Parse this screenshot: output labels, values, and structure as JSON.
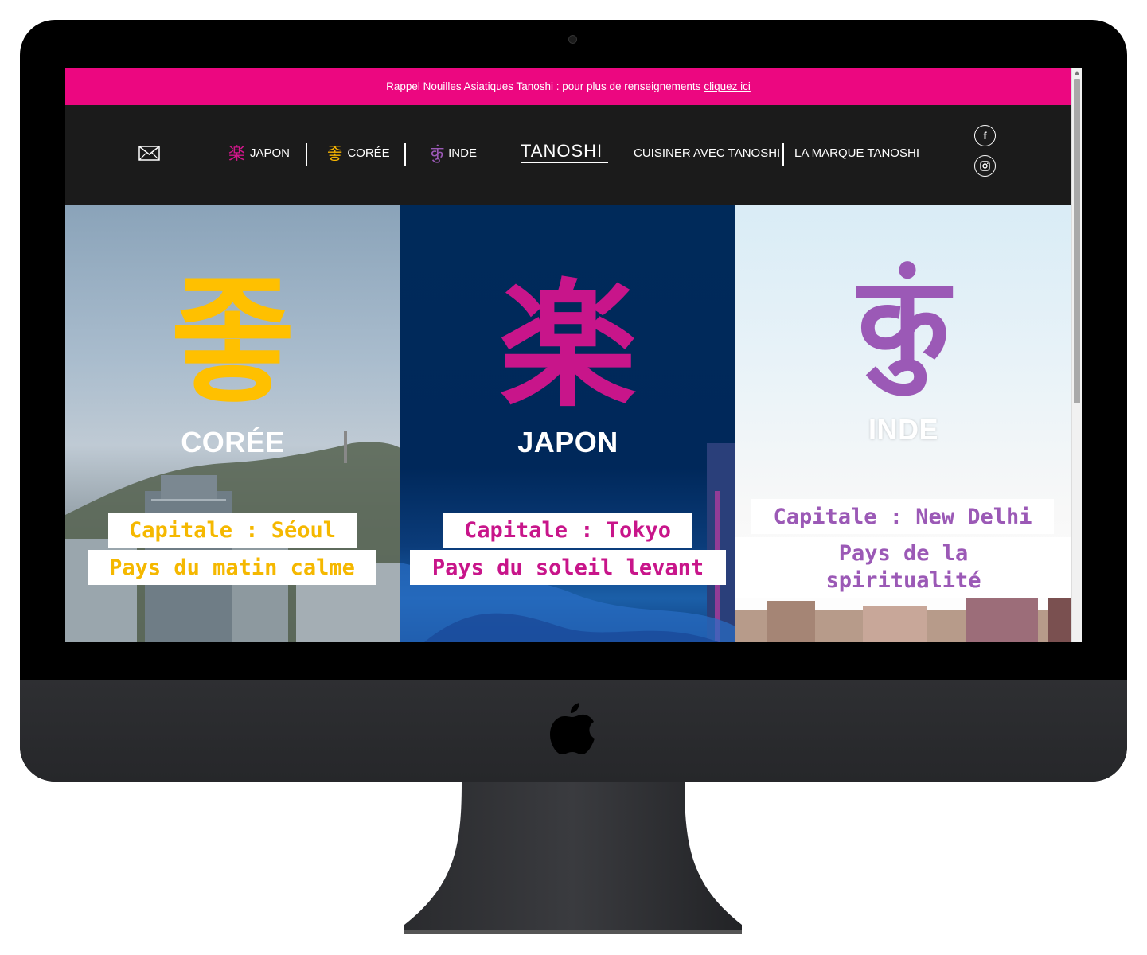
{
  "announcement": {
    "text": "Rappel Nouilles Asiatiques Tanoshi : pour plus de renseignements",
    "link": "cliquez ici"
  },
  "nav": {
    "mail_icon": "envelope-icon",
    "items": [
      {
        "glyph": "楽",
        "label": "JAPON",
        "color": "#d2168b"
      },
      {
        "glyph": "좋",
        "label": "CORÉE",
        "color": "#f5b301"
      },
      {
        "glyph": "कुं",
        "label": "INDE",
        "color": "#9b59b6"
      }
    ],
    "logo": "TANOSHI",
    "right_items": [
      "CUISINER AVEC TANOSHI",
      "LA MARQUE TANOSHI"
    ],
    "social": {
      "facebook": "f",
      "instagram": "◎"
    }
  },
  "panels": [
    {
      "glyph": "좋",
      "glyph_color": "#ffc000",
      "country": "CORÉE",
      "country_color": "#ffffff",
      "capital": "Capitale : Séoul",
      "tagline": "Pays du matin calme",
      "text_color": "#f5b800"
    },
    {
      "glyph": "楽",
      "glyph_color": "#c8158a",
      "country": "JAPON",
      "country_color": "#ffffff",
      "capital": "Capitale : Tokyo",
      "tagline": "Pays du soleil levant",
      "text_color": "#c8158a"
    },
    {
      "glyph": "कुं",
      "glyph_color": "#9b59b6",
      "country": "INDE",
      "country_color": "#ffffff",
      "capital": "Capitale : New Delhi",
      "tagline": "Pays de la spiritualité",
      "text_color": "#9b59b6"
    }
  ],
  "colors": {
    "announcement_bg": "#ec0780",
    "navbar_bg": "#1b1b1b"
  }
}
